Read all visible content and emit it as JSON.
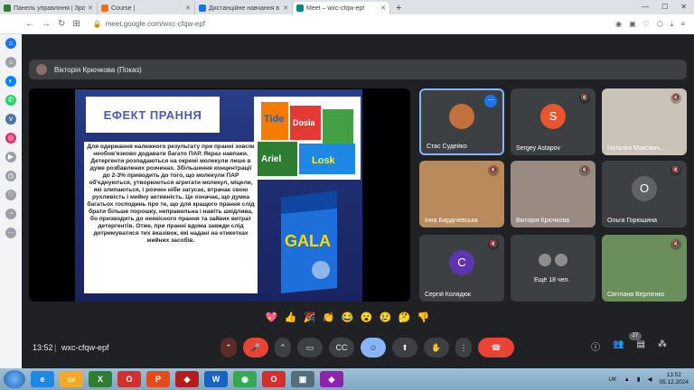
{
  "browser": {
    "tabs": [
      {
        "title": "Панель управління | Зро",
        "color": "#2e7d32",
        "active": false
      },
      {
        "title": "Course |",
        "color": "#e8711a",
        "active": false
      },
      {
        "title": "Дистанційне навчання в",
        "color": "#1a73e8",
        "active": false
      },
      {
        "title": "Meet – wxc-cfqw-epf",
        "color": "#00897b",
        "active": true
      }
    ],
    "url": "meet.google.com/wxc-cfqw-epf"
  },
  "presenter": {
    "name": "Вікторія Крючкова (Показ)"
  },
  "slide": {
    "title": "ЕФЕКТ ПРАННЯ",
    "body": "Для одержання належного результату при пранні зовсім необов'язково додавати багато ПАР. Якраз навпаки. Детергенти розпадаються на окремі молекули лише в дуже розбавлених розчинах. Збільшення концентрації до 2-3% приводить до того, що молекули ПАР об'єднуються, утворюються агрегати молекул, міцели, які злипаються, і розчин ніби загусає, втрачає свою рухливість і мийну активність. Це означає, що думка багатьох господинь про те, що для кращого прання слід брати більше порошку, неправильна і навіть шкідлива, бо призводить до неякісного прання та зайвих витрат детергентів. Отже, при пранні вдома завжди слід дотримуватися тих вказівок, які надані на етикетках мийних засобів.",
    "products_top": [
      "Tide",
      "Dosia",
      "Ariel",
      "Losk"
    ],
    "product_bottom": "GALA"
  },
  "participants": [
    {
      "name": "Стас Судейко",
      "type": "avatar",
      "initial": "",
      "color": "#c2703d",
      "speaking": true,
      "muted": false
    },
    {
      "name": "Sergey Astapov",
      "type": "avatar",
      "initial": "S",
      "color": "#e8552e",
      "speaking": false,
      "muted": true
    },
    {
      "name": "Наталка Максимч...",
      "type": "video",
      "color": "#c9c3b8",
      "speaking": false,
      "muted": true
    },
    {
      "name": "Інна Бардічевська",
      "type": "video",
      "color": "#b88a5c",
      "speaking": false,
      "muted": true
    },
    {
      "name": "Вікторія Крючкова",
      "type": "video",
      "color": "#9a8b82",
      "speaking": false,
      "muted": true
    },
    {
      "name": "Ольга Горюшина",
      "type": "avatar",
      "initial": "О",
      "color": "#5f6368",
      "speaking": false,
      "muted": true
    },
    {
      "name": "Сергій Колядюк",
      "type": "avatar",
      "initial": "С",
      "color": "#5e35b1",
      "speaking": false,
      "muted": true
    },
    {
      "name": "Ещё 18 чел.",
      "type": "more",
      "color": "#3c4043",
      "speaking": false,
      "muted": false
    },
    {
      "name": "Світлана Верлієнко",
      "type": "video",
      "color": "#6b8f5a",
      "speaking": false,
      "muted": true
    }
  ],
  "reactions": [
    "💖",
    "👍",
    "🎉",
    "👏",
    "😂",
    "😮",
    "😢",
    "🤔",
    "👎"
  ],
  "controls": {
    "time": "13:52",
    "meeting_code": "wxc-cfqw-epf",
    "participant_count": "27"
  },
  "taskbar": {
    "lang": "UK",
    "time": "13:52",
    "date": "05.12.2024"
  }
}
